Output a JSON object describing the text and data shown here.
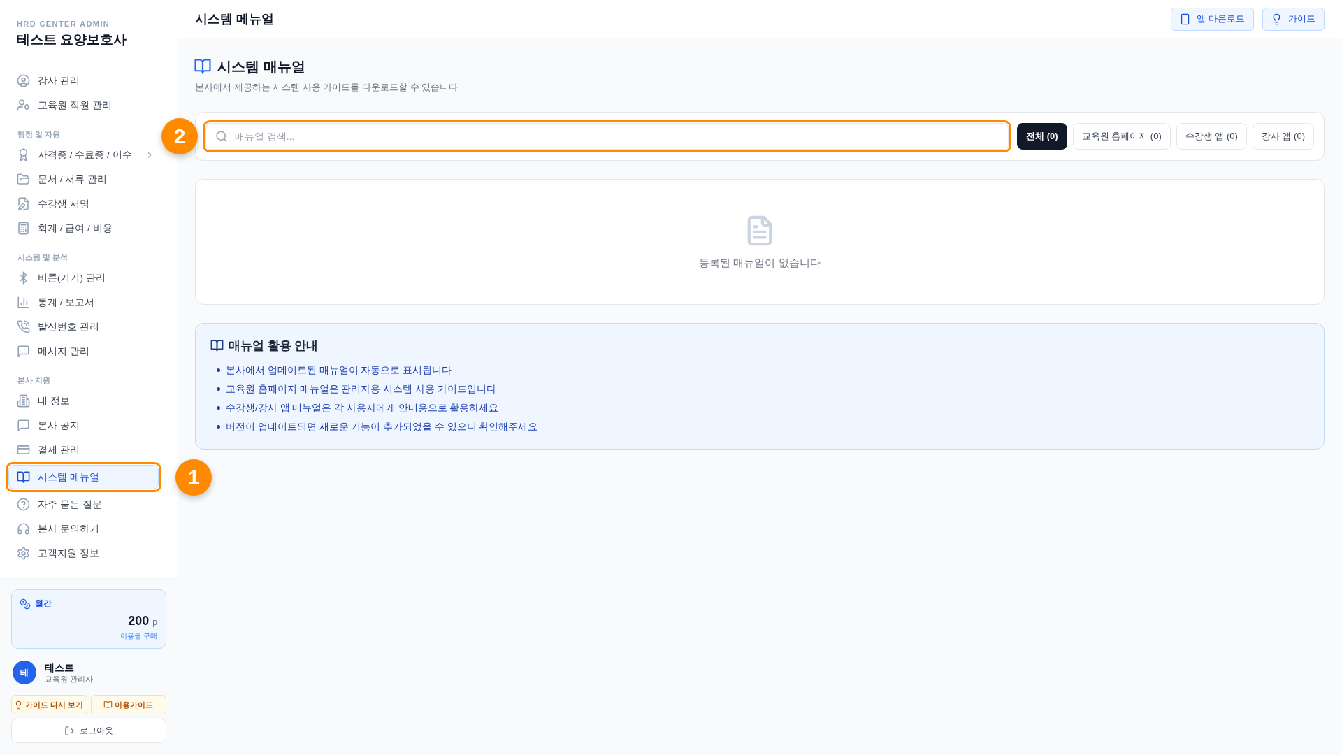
{
  "sidebar": {
    "brand_caption": "HRD CENTER ADMIN",
    "brand_title": "테스트 요양보호사",
    "nav_groups": [
      {
        "items": [
          {
            "label": "강사 관리",
            "selected": false
          },
          {
            "label": "교육원 직원 관리",
            "selected": false
          }
        ]
      },
      {
        "heading": "행정 및 자원",
        "items": [
          {
            "label": "자격증 / 수료증 / 이수",
            "selected": false,
            "expanded": false
          },
          {
            "label": "문서 / 서류 관리",
            "selected": false
          },
          {
            "label": "수강생 서명",
            "selected": false
          },
          {
            "label": "회계 / 급여 / 비용",
            "selected": false
          }
        ]
      },
      {
        "heading": "시스템 및 분석",
        "items": [
          {
            "label": "비콘(기기) 관리",
            "selected": false
          },
          {
            "label": "통계 / 보고서",
            "selected": false
          },
          {
            "label": "발신번호 관리",
            "selected": false
          },
          {
            "label": "메시지 관리",
            "selected": false
          }
        ]
      },
      {
        "heading": "본사 지원",
        "items": [
          {
            "label": "내 정보",
            "selected": false
          },
          {
            "label": "본사 공지",
            "selected": false
          },
          {
            "label": "결제 관리",
            "selected": false
          },
          {
            "label": "시스템 메뉴얼",
            "selected": true,
            "callout": "1"
          },
          {
            "label": "자주 묻는 질문",
            "selected": false
          },
          {
            "label": "본사 문의하기",
            "selected": false
          },
          {
            "label": "고객지원 정보",
            "selected": false
          }
        ]
      }
    ],
    "points": {
      "period": "월간",
      "amount": "200",
      "unit": "p",
      "link": "이용권 구매"
    },
    "user": {
      "initial": "테",
      "name": "테스트",
      "role": "교육원 관리자"
    },
    "help_buttons": [
      {
        "label": "가이드 다시 보기"
      },
      {
        "label": "이용가이드"
      }
    ],
    "logout": {
      "label": "로그아웃"
    }
  },
  "topbar": {
    "title": "시스템 메뉴얼",
    "actions": [
      {
        "label": "앱 다운로드"
      },
      {
        "label": "가이드"
      }
    ]
  },
  "page": {
    "title": "시스템 매뉴얼",
    "subtitle": "본사에서 제공하는 시스템 사용 가이드를 다운로드할 수 있습니다"
  },
  "search": {
    "placeholder": "매뉴얼 검색...",
    "callout": "2"
  },
  "filters": [
    {
      "label": "전체 (0)",
      "selected": true
    },
    {
      "label": "교육원 홈페이지 (0)",
      "selected": false
    },
    {
      "label": "수강생 앱 (0)",
      "selected": false
    },
    {
      "label": "강사 앱 (0)",
      "selected": false
    }
  ],
  "empty_state": {
    "message": "등록된 매뉴얼이 없습니다"
  },
  "guide": {
    "title": "매뉴얼 활용 안내",
    "items": [
      "본사에서 업데이트된 매뉴얼이 자동으로 표시됩니다",
      "교육원 홈페이지 매뉴얼은 관리자용 시스템 사용 가이드입니다",
      "수강생/강사 앱 매뉴얼은 각 사용자에게 안내용으로 활용하세요",
      "버전이 업데이트되면 새로운 기능이 추가되었을 수 있으니 확인해주세요"
    ]
  }
}
